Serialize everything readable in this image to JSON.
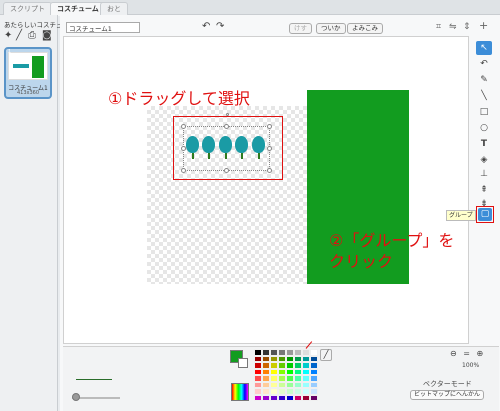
{
  "tabs": [
    {
      "label": "スクリプト"
    },
    {
      "label": "コスチューム"
    },
    {
      "label": "おと"
    }
  ],
  "sidebar": {
    "new_costume_label": "あたらしいコスチューム:",
    "new_icons": [
      "paintbrush-icon",
      "pencil-icon",
      "upload-icon",
      "camera-icon"
    ],
    "costume": {
      "number": "1",
      "name": "コスチューム1",
      "size": "413x360"
    }
  },
  "editor": {
    "costume_name": "コスチューム1",
    "clear_label": "けす",
    "add_label": "ついか",
    "import_label": "よみこみ"
  },
  "tools": [
    {
      "name": "select-tool",
      "glyph": "↖"
    },
    {
      "name": "reshape-tool",
      "glyph": "↶"
    },
    {
      "name": "pencil-tool",
      "glyph": "✎"
    },
    {
      "name": "line-tool",
      "glyph": "╲"
    },
    {
      "name": "rectangle-tool",
      "glyph": "□"
    },
    {
      "name": "ellipse-tool",
      "glyph": "○"
    },
    {
      "name": "text-tool",
      "glyph": "T"
    },
    {
      "name": "fill-tool",
      "glyph": "◈"
    },
    {
      "name": "stamp-tool",
      "glyph": "⊥"
    },
    {
      "name": "front-tool",
      "glyph": "⇞"
    },
    {
      "name": "back-tool",
      "glyph": "⇟"
    },
    {
      "name": "group-tool",
      "glyph": "▢"
    }
  ],
  "tooltip": "グループ",
  "annotations": {
    "step1": "①ドラッグして選択",
    "step2_line1": "②「グループ」を",
    "step2_line2": "クリック"
  },
  "bottom": {
    "zoom_percent": "100%",
    "mode_label": "ベクターモード",
    "bitmap_button": "ビットマップにへんかん"
  },
  "colors": {
    "accent": "#3c8dd8",
    "annotation_red": "#e01010",
    "shape_green": "#129c1f",
    "tree_teal": "#1a9ba5"
  },
  "palette": [
    "#000000",
    "#333333",
    "#555555",
    "#777777",
    "#999999",
    "#bbbbbb",
    "#dddddd",
    "#ffffff",
    "#990000",
    "#994c00",
    "#999900",
    "#4c9900",
    "#009900",
    "#00994c",
    "#009999",
    "#004c99",
    "#cc0000",
    "#cc6600",
    "#cccc00",
    "#66cc00",
    "#00cc00",
    "#00cc66",
    "#00cccc",
    "#0066cc",
    "#ff0000",
    "#ff8000",
    "#ffff00",
    "#80ff00",
    "#00ff00",
    "#00ff80",
    "#00ffff",
    "#0080ff",
    "#ff4d4d",
    "#ffa64d",
    "#ffff66",
    "#a6ff4d",
    "#4dff4d",
    "#4dffa6",
    "#66ffff",
    "#4da6ff",
    "#ff9999",
    "#ffcc99",
    "#ffff99",
    "#ccff99",
    "#99ff99",
    "#99ffcc",
    "#99ffff",
    "#99ccff",
    "#ffcccc",
    "#ffe5cc",
    "#ffffcc",
    "#e5ffcc",
    "#ccffcc",
    "#ccffe5",
    "#ccffff",
    "#cce5ff",
    "#cc00cc",
    "#9900cc",
    "#6600cc",
    "#3300cc",
    "#0000cc",
    "#cc0066",
    "#990033",
    "#660066"
  ]
}
